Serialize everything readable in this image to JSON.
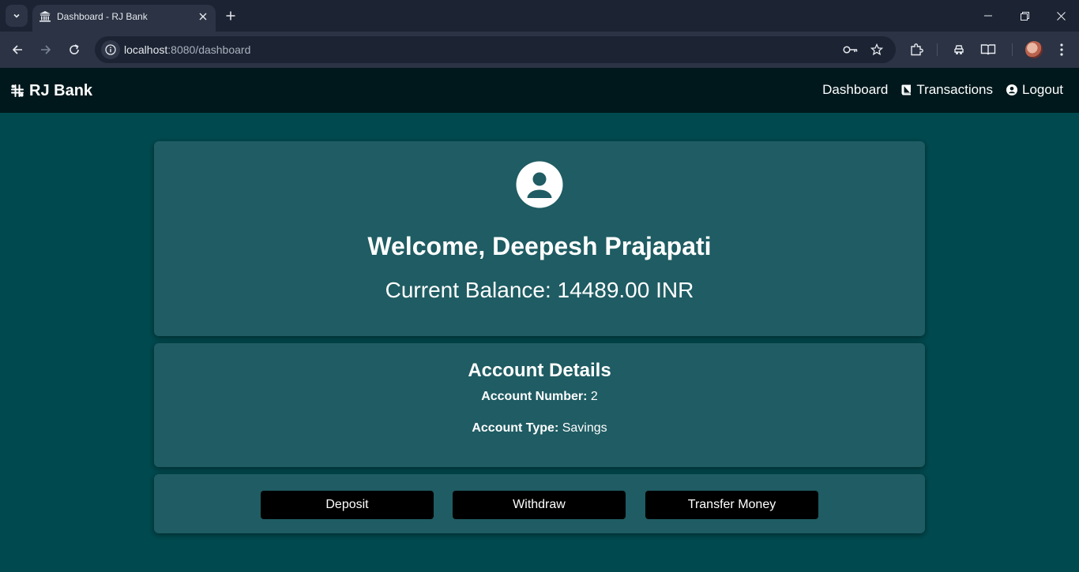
{
  "browser": {
    "tab_title": "Dashboard - RJ Bank",
    "url_host": "localhost",
    "url_rest": ":8080/dashboard"
  },
  "navbar": {
    "brand": "RJ Bank",
    "links": {
      "dashboard": "Dashboard",
      "transactions": "Transactions",
      "logout": "Logout"
    }
  },
  "welcome": {
    "greeting": "Welcome, Deepesh Prajapati",
    "balance_label": "Current Balance:",
    "balance_value": "14489.00",
    "currency": "INR"
  },
  "account": {
    "title": "Account Details",
    "number_label": "Account Number:",
    "number_value": "2",
    "type_label": "Account Type:",
    "type_value": "Savings"
  },
  "actions": {
    "deposit": "Deposit",
    "withdraw": "Withdraw",
    "transfer": "Transfer Money"
  },
  "colors": {
    "page_bg": "#004a4f",
    "navbar_bg": "#00181c",
    "card_bg": "#1f5c63",
    "button_bg": "#000000"
  },
  "icons": {
    "brand": "slack-like-brand-icon",
    "transactions": "book-icon",
    "logout": "user-circle-icon",
    "profile": "profile-avatar-icon"
  }
}
